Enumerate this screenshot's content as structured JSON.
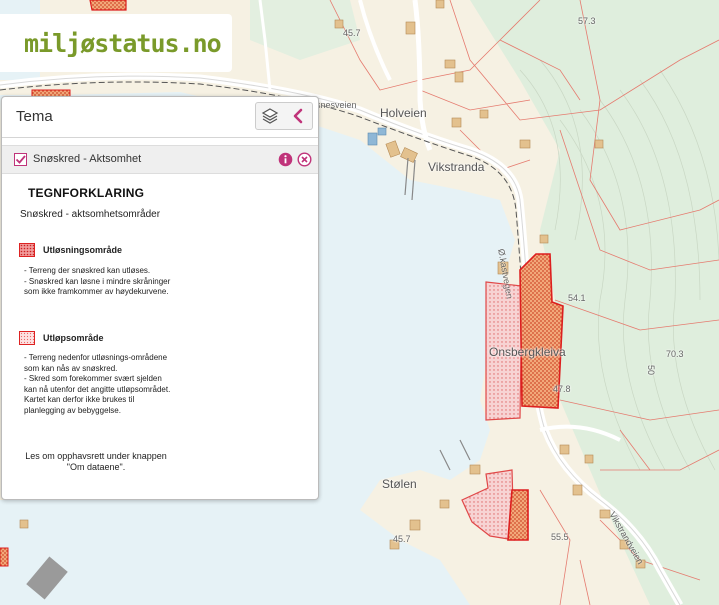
{
  "logo": {
    "text": "miljøstatus.no"
  },
  "panel": {
    "title": "Tema",
    "layers_icon": "layers-icon",
    "collapse_icon": "chevron-left-icon"
  },
  "layer": {
    "checked": true,
    "name": "Snøskred - Aktsomhet",
    "info_icon": "info-icon",
    "remove_icon": "close-circle-icon"
  },
  "legend": {
    "title": "TEGNFORKLARING",
    "subtitle": "Snøskred - aktsomhetsområder",
    "items": [
      {
        "label": "Utløsningsområde",
        "description": "- Terreng der snøskred kan utløses.\n- Snøskred kan løsne i mindre skråninger som ikke framkommer av høydekurvene.",
        "color": "#e03030"
      },
      {
        "label": "Utløpsområde",
        "description": "- Terreng nedenfor utløsnings-områdene som kan nås av snøskred.\n- Skred som forekommer svært sjelden kan nå utenfor det angitte utløpsområdet. Kartet kan derfor ikke brukes til planlegging av bebyggelse.",
        "color": "#e87070"
      }
    ],
    "copyright": "Les om opphavsrett under knappen \"Om dataene\"."
  },
  "map": {
    "place_names": [
      "Holveien",
      "Vikstranda",
      "Onsbergkleiva",
      "Stølen"
    ],
    "road_labels": [
      "snesveien",
      "Ø.kastvegen",
      "Vikstrandveien"
    ],
    "elevations": [
      "45.7",
      "57.3",
      "54.1",
      "70.3",
      "47.8",
      "55.5",
      "45.7",
      "50"
    ],
    "colors": {
      "water": "#e8f3f7",
      "land": "#f6f1e3",
      "forest": "#dfeedd",
      "release_zone": "#e03030",
      "runout_zone": "#e87070",
      "accent": "#c0337a"
    }
  }
}
